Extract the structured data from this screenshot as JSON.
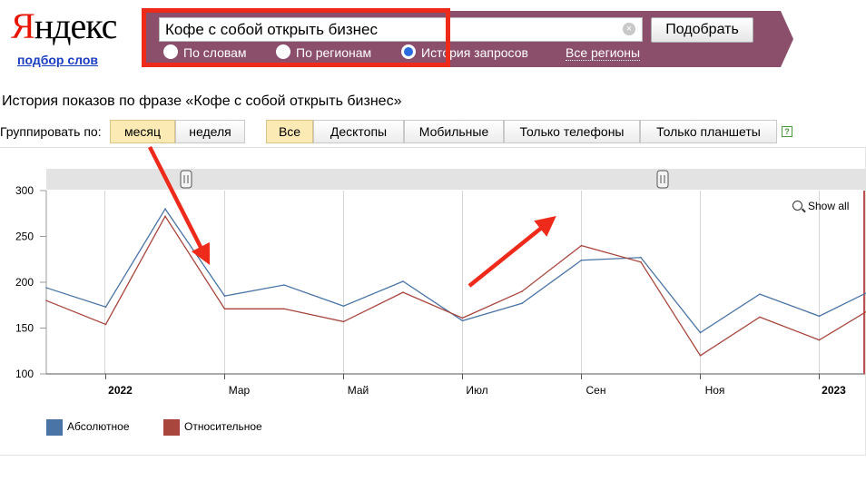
{
  "header": {
    "logo_first_letter": "Я",
    "logo_rest": "ндекс",
    "logo_subtitle": "подбор слов"
  },
  "search": {
    "value": "Кофе с собой открыть бизнес",
    "submit_label": "Подобрать",
    "modes": [
      {
        "label": "По словам",
        "selected": false
      },
      {
        "label": "По регионам",
        "selected": false
      },
      {
        "label": "История запросов",
        "selected": true
      }
    ],
    "regions_link": "Все регионы"
  },
  "history_title": "История показов по фразе «Кофе с собой открыть бизнес»",
  "grouping": {
    "label": "Группировать по:",
    "options": [
      {
        "label": "месяц",
        "selected": true
      },
      {
        "label": "неделя",
        "selected": false
      }
    ]
  },
  "devices": {
    "options": [
      {
        "label": "Все",
        "selected": true
      },
      {
        "label": "Десктопы",
        "selected": false
      },
      {
        "label": "Мобильные",
        "selected": false
      },
      {
        "label": "Только телефоны",
        "selected": false
      },
      {
        "label": "Только планшеты",
        "selected": false
      }
    ],
    "help_icon": "?"
  },
  "show_all_label": "Show all",
  "colors": {
    "absolute": "#4a74a5",
    "relative": "#a8463d",
    "accent_band": "#8b4f6c",
    "annotation_red": "#ee2b1b"
  },
  "chart_data": {
    "type": "line",
    "x": [
      "2021-11",
      "2021-12",
      "2022-01",
      "2022-02",
      "2022-03",
      "2022-04",
      "2022-05",
      "2022-06",
      "2022-07",
      "2022-08",
      "2022-09",
      "2022-10",
      "2022-11",
      "2022-12",
      "2023-01",
      "2023-02"
    ],
    "x_tick_labels": [
      "2022",
      "Мар",
      "Май",
      "Июл",
      "Сен",
      "Ноя",
      "2023"
    ],
    "ylim": [
      100,
      300
    ],
    "y_ticks": [
      100,
      150,
      200,
      250,
      300
    ],
    "series": [
      {
        "name": "Абсолютное",
        "values": [
          194,
          173,
          280,
          185,
          197,
          174,
          201,
          158,
          177,
          224,
          227,
          145,
          187,
          163,
          195,
          186
        ]
      },
      {
        "name": "Относительное",
        "values": [
          180,
          154,
          272,
          171,
          171,
          157,
          189,
          161,
          190,
          240,
          222,
          120,
          162,
          137,
          176,
          173
        ]
      }
    ],
    "legend_position": "bottom-left",
    "grid": true
  }
}
